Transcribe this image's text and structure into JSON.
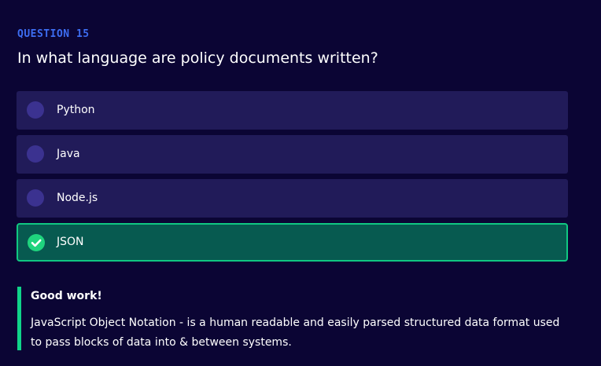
{
  "quiz": {
    "question_number": "QUESTION 15",
    "question_text": "In what language are policy documents written?",
    "options": [
      {
        "label": "Python",
        "selected": false,
        "correct": false
      },
      {
        "label": "Java",
        "selected": false,
        "correct": false
      },
      {
        "label": "Node.js",
        "selected": false,
        "correct": false
      },
      {
        "label": "JSON",
        "selected": true,
        "correct": true
      }
    ],
    "feedback": {
      "title": "Good work!",
      "text": "JavaScript Object Notation - is a human readable and easily parsed structured data format used to pass blocks of data into & between systems."
    },
    "icons": {
      "selected": "check-circle-icon",
      "unselected": "radio-circle-icon"
    }
  },
  "colors": {
    "background": "#0b0534",
    "accent_blue": "#3d6df2",
    "option_bg": "#211b59",
    "radio": "#3b3290",
    "correct_bg": "#075a50",
    "correct_border": "#10c882",
    "check_green": "#1fd47e",
    "feedback_bar": "#10d48a"
  }
}
